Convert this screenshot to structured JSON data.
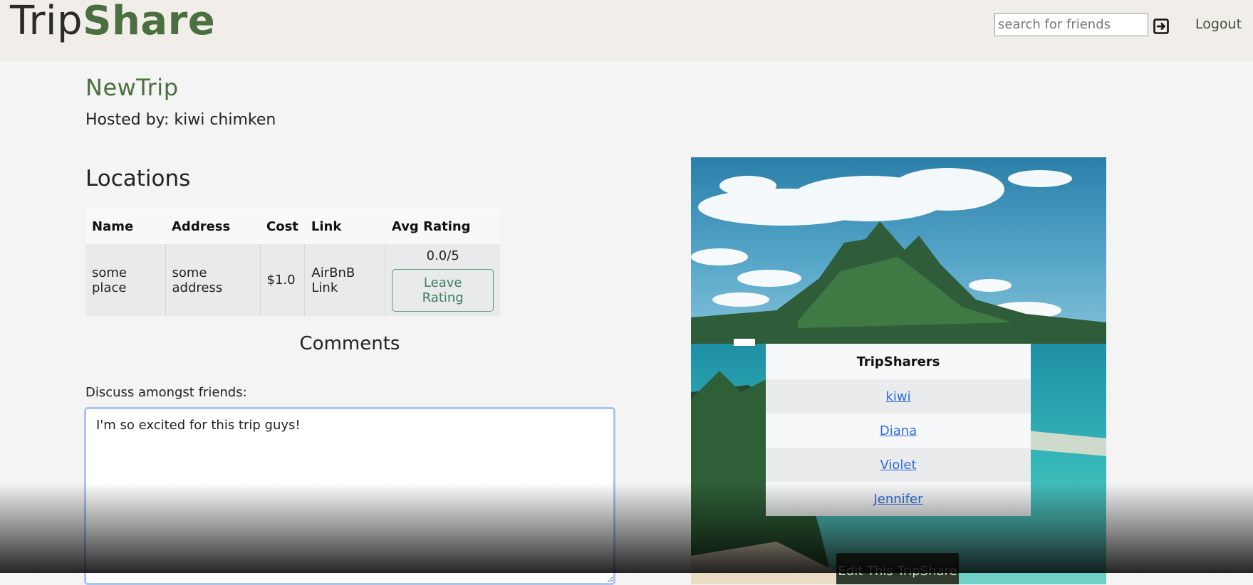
{
  "nav": {
    "brand_trip": "Trip",
    "brand_share": "Share",
    "search_placeholder": "search for friends",
    "logout_label": "Logout"
  },
  "trip": {
    "title": "NewTrip",
    "host": "Hosted by: kiwi chimken"
  },
  "locations": {
    "heading": "Locations",
    "columns": [
      "Name",
      "Address",
      "Cost",
      "Link",
      "Avg Rating"
    ],
    "rows": [
      {
        "name": "some place",
        "address": "some address",
        "cost": "$1.0",
        "link": "AirBnB Link",
        "rating": "0.0/5",
        "rate_button": "Leave Rating"
      }
    ]
  },
  "comments": {
    "heading": "Comments",
    "label": "Discuss amongst friends:",
    "value": "I'm so excited for this trip guys!"
  },
  "tripsharers": {
    "heading": "TripSharers",
    "members": [
      "kiwi",
      "Diana",
      "Violet",
      "Jennifer"
    ],
    "edit_button": "Edit This TripShare"
  },
  "colors": {
    "brand_green": "#4b6f41",
    "navbar_bg": "#f1eeea",
    "link_blue": "#2f6de1",
    "rate_button": "#5f9a7a",
    "textarea_focus": "#a9c6f2"
  },
  "icons": {
    "search_submit": "login-arrow-icon"
  }
}
